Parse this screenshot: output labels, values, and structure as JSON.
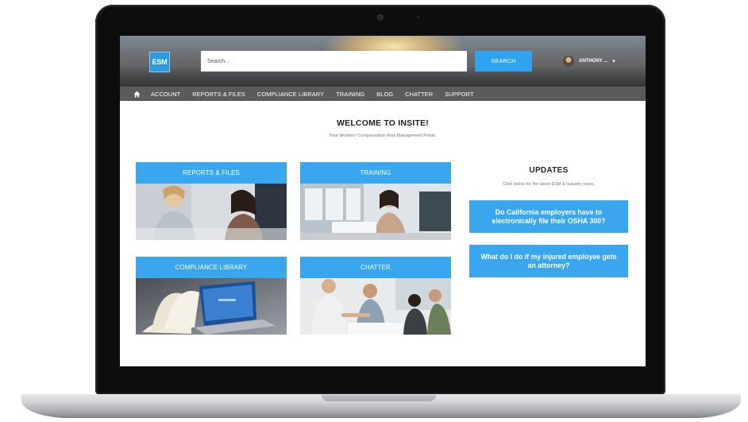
{
  "header": {
    "logo_text": "ESM",
    "search_placeholder": "Search...",
    "search_button": "SEARCH",
    "user_name": "ANTHONY ...",
    "user_caret": "▾"
  },
  "nav": {
    "items": [
      "ACCOUNT",
      "REPORTS & FILES",
      "COMPLIANCE LIBRARY",
      "TRAINING",
      "BLOG",
      "CHATTER",
      "SUPPORT"
    ]
  },
  "main": {
    "title": "WELCOME TO INSITE!",
    "subtitle": "Your Workers' Compensation Risk Management Portal.",
    "tiles": [
      {
        "label": "REPORTS & FILES"
      },
      {
        "label": "TRAINING"
      },
      {
        "label": "COMPLIANCE LIBRARY"
      },
      {
        "label": "CHATTER"
      }
    ]
  },
  "updates": {
    "title": "UPDATES",
    "subtitle": "Click below for the latest ESM & Industry news.",
    "items": [
      {
        "text": "Do California employers have to electronically file their OSHA 300?"
      },
      {
        "text": "What do I do if my injured employee gets an attorney?"
      }
    ]
  },
  "colors": {
    "accent": "#3aa6ee",
    "nav_bg": "#5b5b5b",
    "bezel": "#0d0d0e"
  }
}
